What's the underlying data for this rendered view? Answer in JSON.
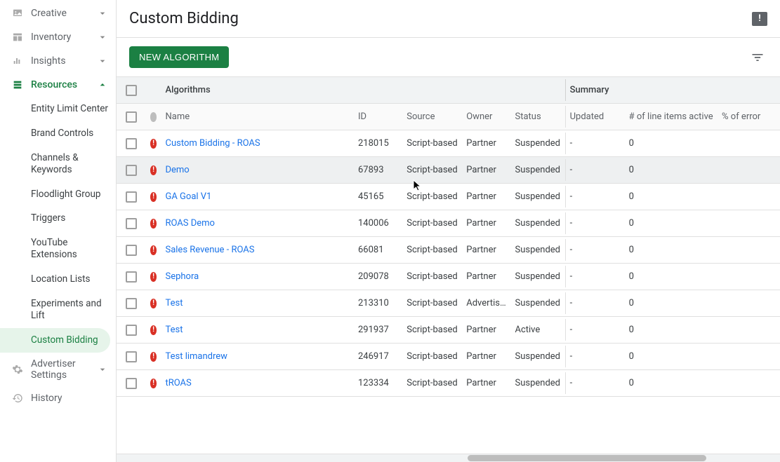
{
  "sidebar": {
    "top_items": [
      {
        "label": "Creative",
        "icon": "creative"
      },
      {
        "label": "Inventory",
        "icon": "inventory"
      },
      {
        "label": "Insights",
        "icon": "insights"
      }
    ],
    "resources_label": "Resources",
    "sub_items": [
      "Entity Limit Center",
      "Brand Controls",
      "Channels & Keywords",
      "Floodlight Group",
      "Triggers",
      "YouTube Extensions",
      "Location Lists",
      "Experiments and Lift",
      "Custom Bidding",
      "Advertiser Settings",
      "History"
    ],
    "active_sub": "Custom Bidding"
  },
  "page": {
    "title": "Custom Bidding",
    "new_button": "NEW ALGORITHM"
  },
  "table": {
    "group_left": "Algorithms",
    "group_right": "Summary",
    "columns": {
      "name": "Name",
      "id": "ID",
      "source": "Source",
      "owner": "Owner",
      "status": "Status",
      "updated": "Updated",
      "line_items": "# of line items active",
      "pct_error": "% of error"
    },
    "rows": [
      {
        "name": "Custom Bidding - ROAS",
        "id": "218015",
        "source": "Script-based",
        "owner": "Partner",
        "status": "Suspended",
        "updated": "-",
        "line_items": "0"
      },
      {
        "name": "Demo",
        "id": "67893",
        "source": "Script-based",
        "owner": "Partner",
        "status": "Suspended",
        "updated": "-",
        "line_items": "0",
        "hover": true
      },
      {
        "name": "GA Goal V1",
        "id": "45165",
        "source": "Script-based",
        "owner": "Partner",
        "status": "Suspended",
        "updated": "-",
        "line_items": "0"
      },
      {
        "name": "ROAS Demo",
        "id": "140006",
        "source": "Script-based",
        "owner": "Partner",
        "status": "Suspended",
        "updated": "-",
        "line_items": "0"
      },
      {
        "name": "Sales Revenue - ROAS",
        "id": "66081",
        "source": "Script-based",
        "owner": "Partner",
        "status": "Suspended",
        "updated": "-",
        "line_items": "0"
      },
      {
        "name": "Sephora",
        "id": "209078",
        "source": "Script-based",
        "owner": "Partner",
        "status": "Suspended",
        "updated": "-",
        "line_items": "0"
      },
      {
        "name": "Test",
        "id": "213310",
        "source": "Script-based",
        "owner": "Advertiser",
        "status": "Suspended",
        "updated": "-",
        "line_items": "0"
      },
      {
        "name": "Test",
        "id": "291937",
        "source": "Script-based",
        "owner": "Partner",
        "status": "Active",
        "updated": "-",
        "line_items": "0"
      },
      {
        "name": "Test limandrew",
        "id": "246917",
        "source": "Script-based",
        "owner": "Partner",
        "status": "Suspended",
        "updated": "-",
        "line_items": "0"
      },
      {
        "name": "tROAS",
        "id": "123334",
        "source": "Script-based",
        "owner": "Partner",
        "status": "Suspended",
        "updated": "-",
        "line_items": "0"
      }
    ]
  }
}
